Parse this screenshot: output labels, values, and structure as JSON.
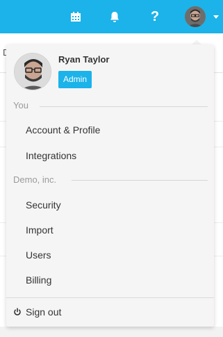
{
  "topbar": {
    "background_color": "#1bb3e9",
    "icons": [
      "calendar-icon",
      "bell-icon",
      "help-icon",
      "avatar"
    ],
    "help_glyph": "?"
  },
  "background": {
    "partial_letter": "D"
  },
  "profile": {
    "name": "Ryan Taylor",
    "role": "Admin",
    "role_color": "#1bb3e9"
  },
  "sections": {
    "you": {
      "title": "You",
      "items": [
        "Account & Profile",
        "Integrations"
      ]
    },
    "company": {
      "title": "Demo, inc.",
      "items": [
        "Security",
        "Import",
        "Users",
        "Billing"
      ]
    }
  },
  "signout": {
    "label": "Sign out",
    "icon": "power-icon"
  }
}
